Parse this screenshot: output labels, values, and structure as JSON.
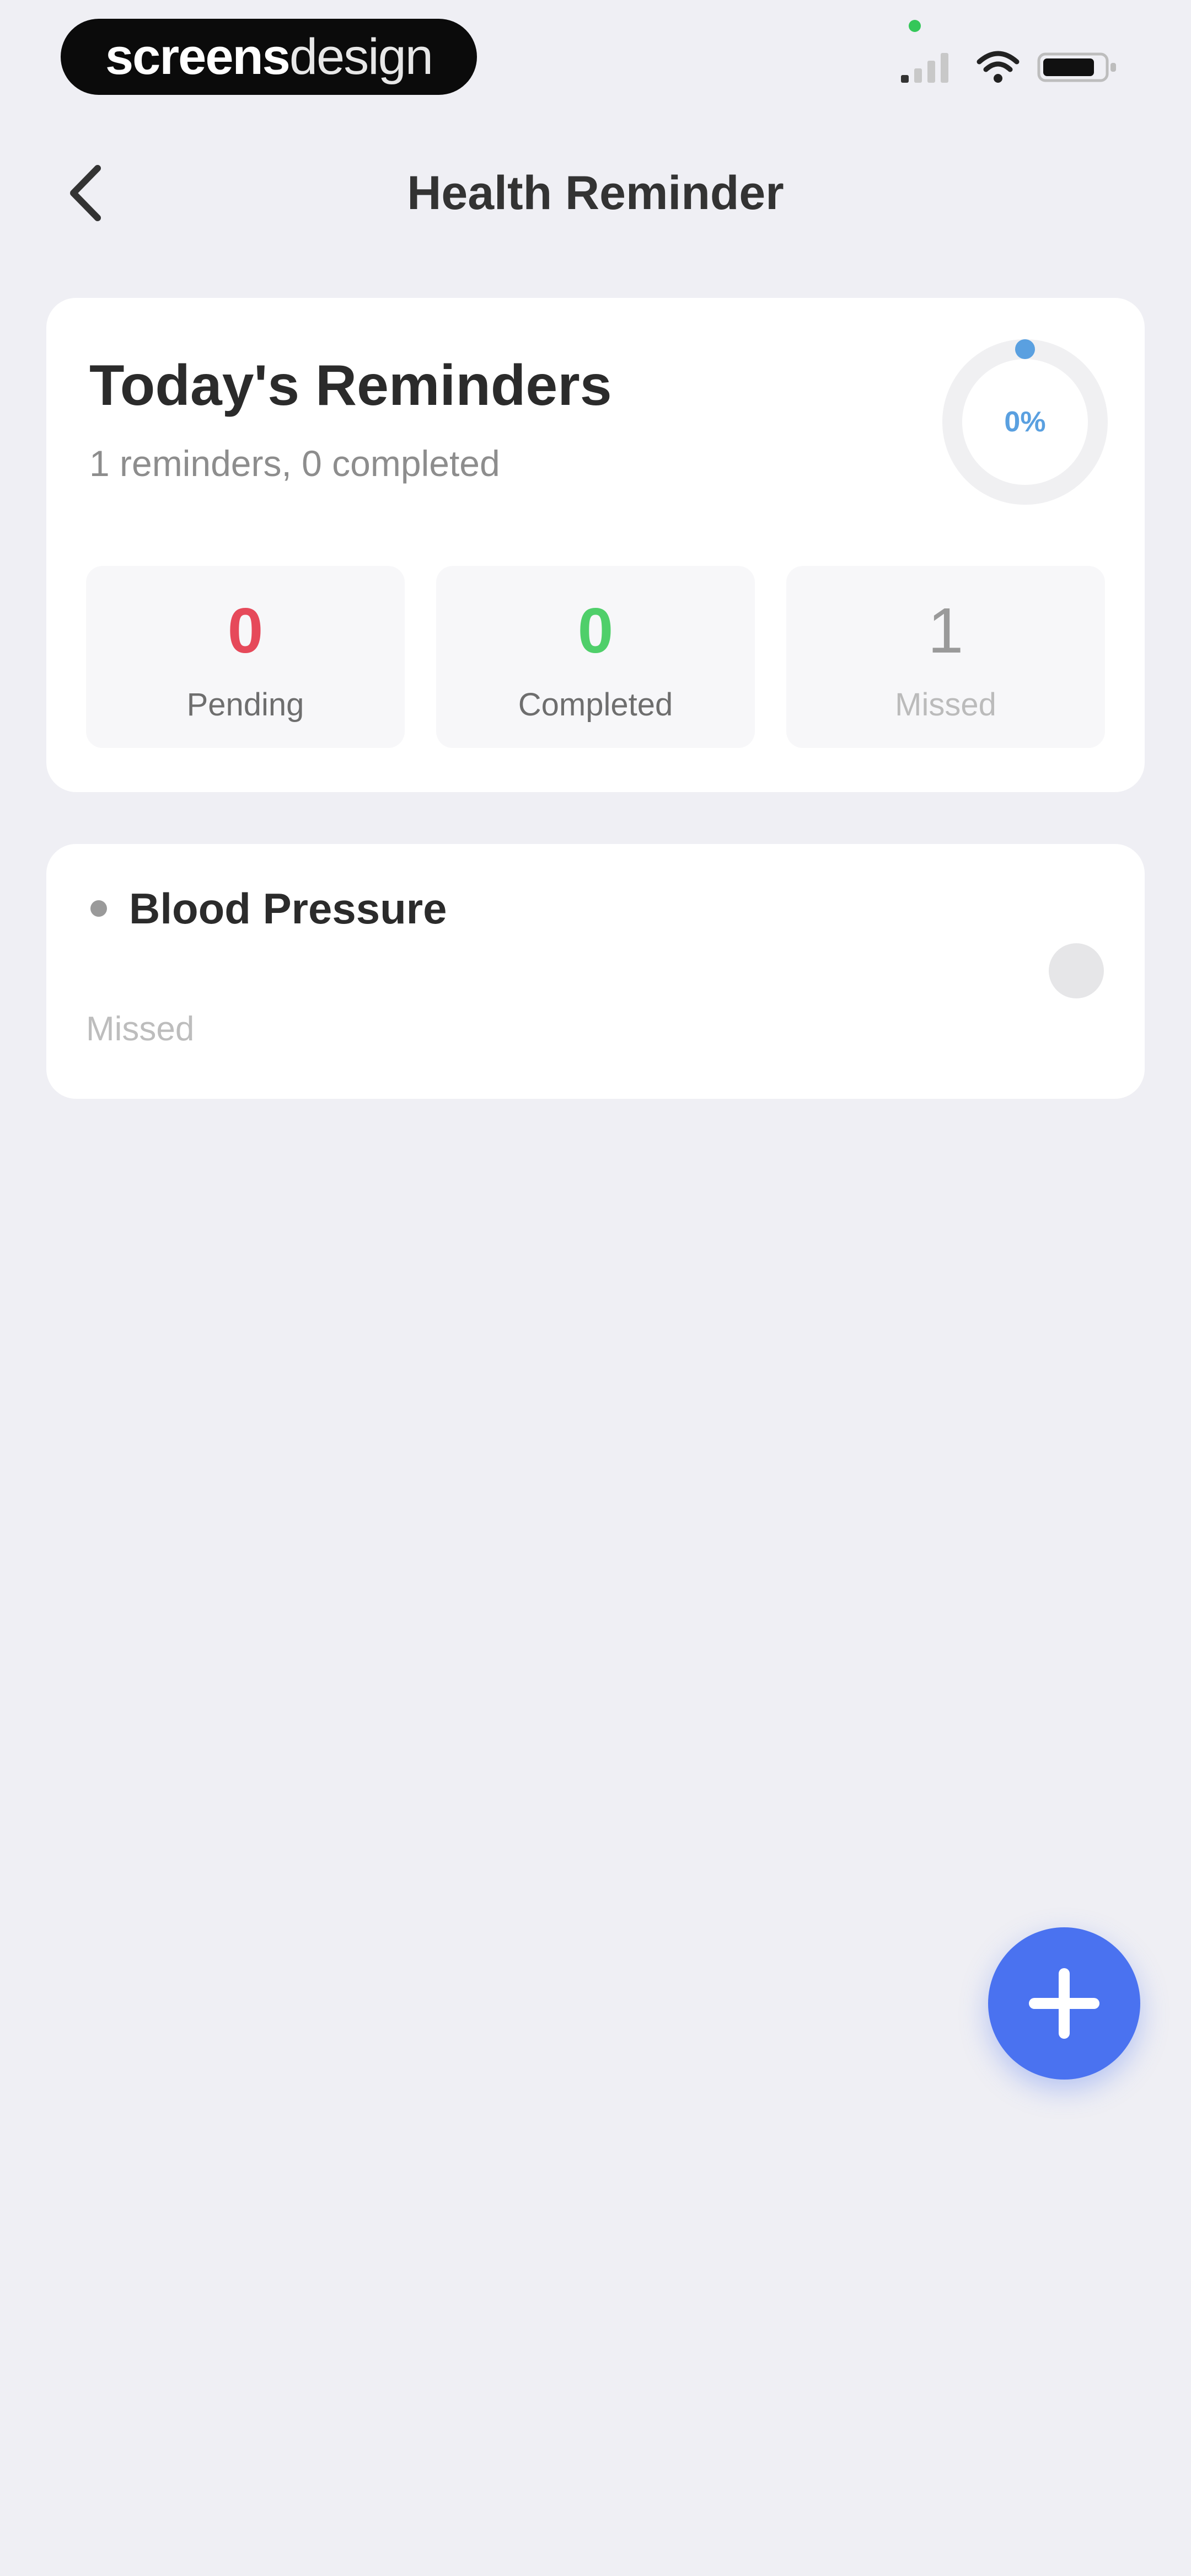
{
  "status_bar": {
    "brand_bold": "screens",
    "brand_light": "design",
    "icons": [
      "signal-icon",
      "wifi-icon",
      "battery-icon"
    ],
    "status_dot_color": "#34c759"
  },
  "nav": {
    "title": "Health Reminder",
    "back_icon": "chevron-left-icon"
  },
  "summary": {
    "title": "Today's Reminders",
    "subtitle": "1 reminders, 0 completed",
    "progress_label": "0%",
    "progress_value": 0,
    "progress_color": "#5aa0e0",
    "stats": [
      {
        "key": "pending",
        "value": "0",
        "label": "Pending",
        "color": "#e6495a"
      },
      {
        "key": "completed",
        "value": "0",
        "label": "Completed",
        "color": "#4fcf6a"
      },
      {
        "key": "missed",
        "value": "1",
        "label": "Missed",
        "color": "#9a9a9a"
      }
    ]
  },
  "reminders": [
    {
      "title": "Blood Pressure",
      "status": "Missed"
    }
  ],
  "fab": {
    "icon": "plus-icon",
    "color": "#4a72f0"
  }
}
